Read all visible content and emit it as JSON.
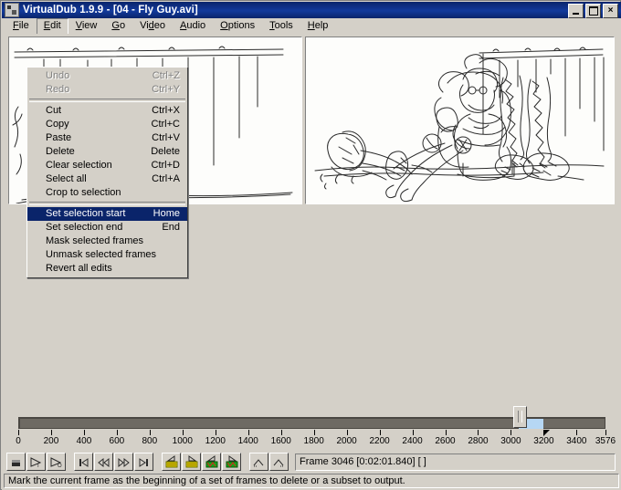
{
  "window": {
    "title": "VirtualDub 1.9.9 - [04 - Fly Guy.avi]",
    "app_icon": "virtualdub-icon",
    "minimize_label": "",
    "maximize_label": "",
    "close_label": "×"
  },
  "menubar": {
    "items": [
      {
        "label": "File",
        "mnemonic": "F"
      },
      {
        "label": "Edit",
        "mnemonic": "E"
      },
      {
        "label": "View",
        "mnemonic": "V"
      },
      {
        "label": "Go",
        "mnemonic": "G"
      },
      {
        "label": "Video",
        "mnemonic": "V"
      },
      {
        "label": "Audio",
        "mnemonic": "A"
      },
      {
        "label": "Options",
        "mnemonic": "O"
      },
      {
        "label": "Tools",
        "mnemonic": "T"
      },
      {
        "label": "Help",
        "mnemonic": "H"
      }
    ],
    "open_index": 1
  },
  "edit_menu": {
    "groups": [
      [
        {
          "label": "Undo",
          "accel": "Ctrl+Z",
          "disabled": true,
          "selected": false
        },
        {
          "label": "Redo",
          "accel": "Ctrl+Y",
          "disabled": true,
          "selected": false
        }
      ],
      [
        {
          "label": "Cut",
          "accel": "Ctrl+X",
          "disabled": false,
          "selected": false
        },
        {
          "label": "Copy",
          "accel": "Ctrl+C",
          "disabled": false,
          "selected": false
        },
        {
          "label": "Paste",
          "accel": "Ctrl+V",
          "disabled": false,
          "selected": false
        },
        {
          "label": "Delete",
          "accel": "Delete",
          "disabled": false,
          "selected": false
        },
        {
          "label": "Clear selection",
          "accel": "Ctrl+D",
          "disabled": false,
          "selected": false
        },
        {
          "label": "Select all",
          "accel": "Ctrl+A",
          "disabled": false,
          "selected": false
        },
        {
          "label": "Crop to selection",
          "accel": "",
          "disabled": false,
          "selected": false
        }
      ],
      [
        {
          "label": "Set selection start",
          "accel": "Home",
          "disabled": false,
          "selected": true
        },
        {
          "label": "Set selection end",
          "accel": "End",
          "disabled": false,
          "selected": false
        },
        {
          "label": "Mask selected frames",
          "accel": "",
          "disabled": false,
          "selected": false
        },
        {
          "label": "Unmask selected frames",
          "accel": "",
          "disabled": false,
          "selected": false
        },
        {
          "label": "Revert all edits",
          "accel": "",
          "disabled": false,
          "selected": false
        }
      ]
    ]
  },
  "panes": {
    "input_label": "input-video-pane",
    "output_label": "output-video-pane"
  },
  "timeline": {
    "min": 0,
    "max": 3576,
    "current_frame": 3046,
    "selection_start": 3046,
    "selection_end": 3200,
    "tick_labels": [
      "0",
      "200",
      "400",
      "600",
      "800",
      "1000",
      "1200",
      "1400",
      "1600",
      "1800",
      "2000",
      "2200",
      "2400",
      "2600",
      "2800",
      "3000",
      "3200",
      "3400",
      "3576"
    ],
    "tick_values": [
      0,
      200,
      400,
      600,
      800,
      1000,
      1200,
      1400,
      1600,
      1800,
      2000,
      2200,
      2400,
      2600,
      2800,
      3000,
      3200,
      3400,
      3576
    ]
  },
  "toolbar": {
    "buttons": [
      {
        "name": "stop-button",
        "tooltip": "Stop"
      },
      {
        "name": "play-input-button",
        "tooltip": "Play input video"
      },
      {
        "name": "play-output-button",
        "tooltip": "Play output video"
      },
      {
        "name": "go-to-start-button",
        "tooltip": "Move to start of video"
      },
      {
        "name": "key-previous-button",
        "tooltip": "Backward"
      },
      {
        "name": "key-next-button",
        "tooltip": "Forward"
      },
      {
        "name": "go-to-end-button",
        "tooltip": "Move to end of video"
      },
      {
        "name": "previous-keyframe-button",
        "tooltip": "Previous key frame"
      },
      {
        "name": "next-keyframe-button",
        "tooltip": "Next key frame"
      },
      {
        "name": "scene-reverse-button",
        "tooltip": "Previous scene"
      },
      {
        "name": "scene-forward-button",
        "tooltip": "Next scene"
      },
      {
        "name": "mark-in-button",
        "tooltip": "Set selection start"
      },
      {
        "name": "mark-out-button",
        "tooltip": "Set selection end"
      }
    ],
    "frame_info": "Frame 3046 [0:02:01.840] [ ]"
  },
  "statusbar": {
    "message": "Mark the current frame as the beginning of a set of frames to delete or a subset to output."
  },
  "colors": {
    "titlebar": "#0a246a",
    "face": "#d4d0c8",
    "selection_highlight": "#0a246a",
    "timeline_track": "#6e6a63",
    "selection_range": "#b6d7f4"
  }
}
